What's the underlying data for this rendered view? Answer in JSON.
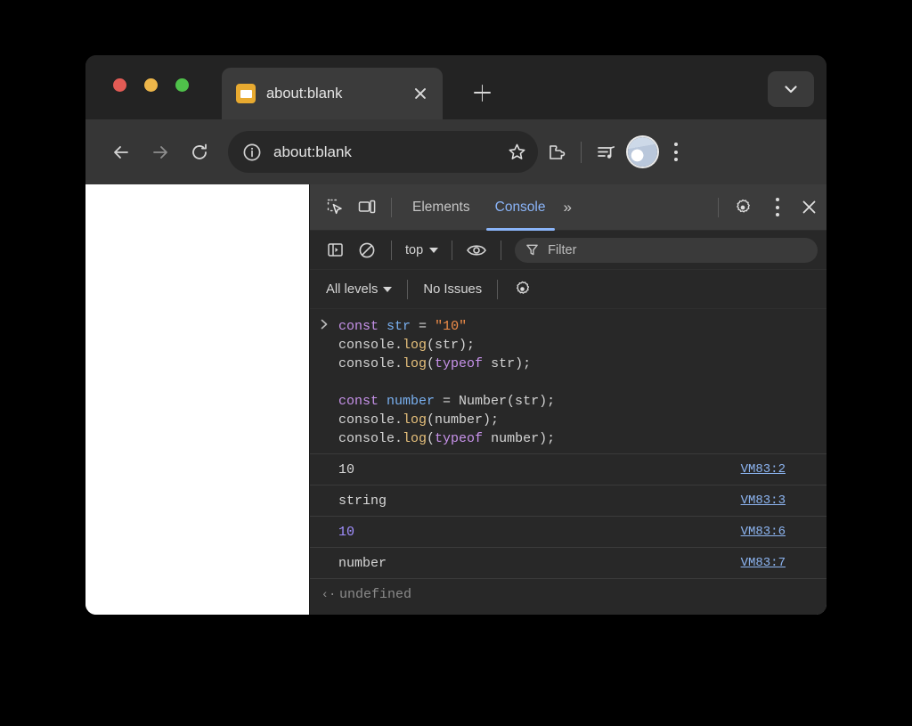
{
  "browser": {
    "tab": {
      "title": "about:blank",
      "favicon": "blank-page-favicon",
      "close_icon": "close-icon"
    },
    "new_tab_label": "+",
    "tab_list_icon": "chevron-down-icon",
    "toolbar": {
      "back_icon": "arrow-left-icon",
      "forward_icon": "arrow-right-icon",
      "reload_icon": "reload-icon",
      "omnibox": {
        "site_info_icon": "info-circle-icon",
        "url": "about:blank",
        "bookmark_icon": "star-icon"
      },
      "extensions_icon": "puzzle-piece-icon",
      "media_icon": "media-playlist-icon",
      "profile_icon": "profile-avatar",
      "menu_icon": "kebab-menu-icon"
    }
  },
  "devtools": {
    "inspect_icon": "inspect-element-icon",
    "device_toolbar_icon": "device-toolbar-icon",
    "tabs": [
      {
        "label": "Elements",
        "active": false
      },
      {
        "label": "Console",
        "active": true
      }
    ],
    "more_tabs_label": "»",
    "settings_icon": "gear-icon",
    "more_options_icon": "kebab-menu-icon",
    "close_icon": "close-icon",
    "filterbar": {
      "sidebar_icon": "console-sidebar-icon",
      "clear_icon": "clear-console-icon",
      "context": "top",
      "eye_icon": "live-expression-icon",
      "filter_icon": "filter-funnel-icon",
      "filter_placeholder": "Filter"
    },
    "levelbar": {
      "levels_label": "All levels",
      "issues_label": "No Issues",
      "settings_icon": "gear-icon"
    },
    "console": {
      "prompt_icon": "prompt-chevron-icon",
      "input_lines": [
        [
          {
            "t": "kw",
            "v": "const"
          },
          {
            "t": "plain",
            "v": " "
          },
          {
            "t": "var",
            "v": "str"
          },
          {
            "t": "plain",
            "v": " = "
          },
          {
            "t": "str",
            "v": "\"10\""
          }
        ],
        [
          {
            "t": "plain",
            "v": "console."
          },
          {
            "t": "fn",
            "v": "log"
          },
          {
            "t": "plain",
            "v": "(str);"
          }
        ],
        [
          {
            "t": "plain",
            "v": "console."
          },
          {
            "t": "fn",
            "v": "log"
          },
          {
            "t": "plain",
            "v": "("
          },
          {
            "t": "kw",
            "v": "typeof"
          },
          {
            "t": "plain",
            "v": " str);"
          }
        ],
        [
          {
            "t": "plain",
            "v": ""
          }
        ],
        [
          {
            "t": "kw",
            "v": "const"
          },
          {
            "t": "plain",
            "v": " "
          },
          {
            "t": "var",
            "v": "number"
          },
          {
            "t": "plain",
            "v": " = Number(str);"
          }
        ],
        [
          {
            "t": "plain",
            "v": "console."
          },
          {
            "t": "fn",
            "v": "log"
          },
          {
            "t": "plain",
            "v": "(number);"
          }
        ],
        [
          {
            "t": "plain",
            "v": "console."
          },
          {
            "t": "fn",
            "v": "log"
          },
          {
            "t": "plain",
            "v": "("
          },
          {
            "t": "kw",
            "v": "typeof"
          },
          {
            "t": "plain",
            "v": " number);"
          }
        ]
      ],
      "output_rows": [
        {
          "value": "10",
          "kind": "string",
          "source": "VM83:2"
        },
        {
          "value": "string",
          "kind": "string",
          "source": "VM83:3"
        },
        {
          "value": "10",
          "kind": "number",
          "source": "VM83:6"
        },
        {
          "value": "number",
          "kind": "string",
          "source": "VM83:7"
        }
      ],
      "result": {
        "arrow": "‹·",
        "value": "undefined"
      }
    }
  },
  "colors": {
    "accent_blue": "#8ab4f8",
    "link_blue": "#8cb4f0",
    "number_purple": "#a18fff",
    "keyword_purple": "#c792ea",
    "string_orange": "#f08d49",
    "function_gold": "#e6c07b",
    "devtools_bg": "#282828",
    "toolbar_bg": "#363636"
  }
}
